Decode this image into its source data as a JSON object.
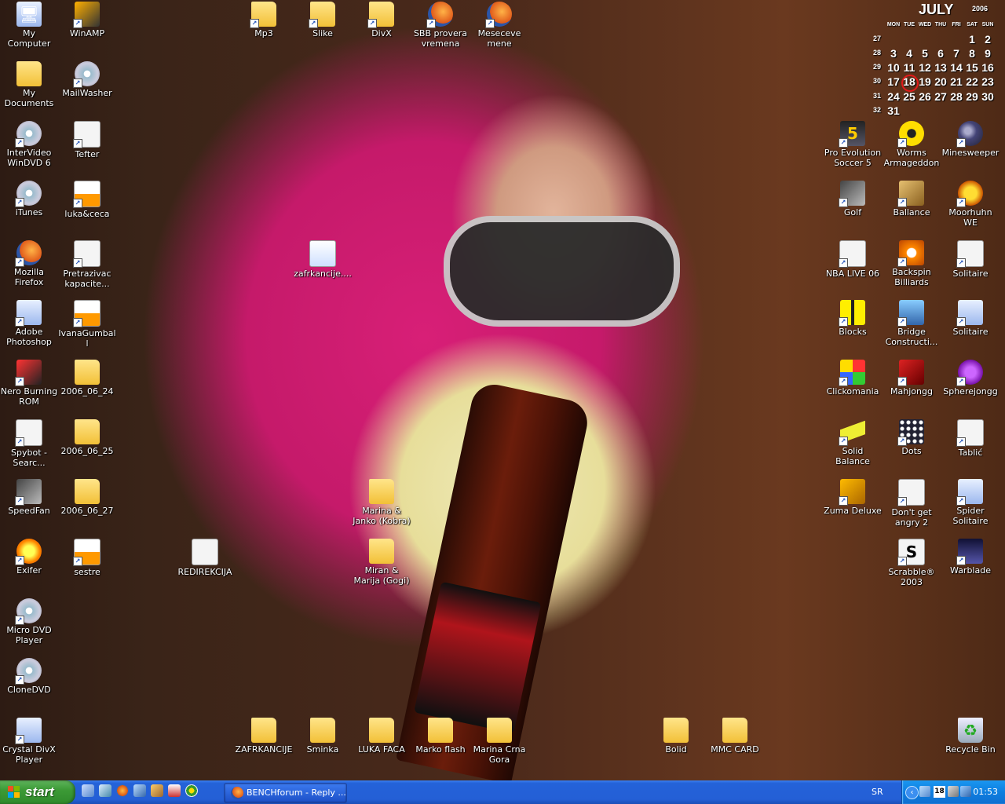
{
  "desktop_icons": {
    "col1": [
      {
        "label": "My Computer"
      },
      {
        "label": "My Documents"
      },
      {
        "label": "InterVideo WinDVD 6"
      },
      {
        "label": "iTunes"
      },
      {
        "label": "Mozilla Firefox"
      },
      {
        "label": "Adobe Photoshop"
      },
      {
        "label": "Nero Burning ROM"
      },
      {
        "label": "Spybot - Searc..."
      },
      {
        "label": "SpeedFan"
      },
      {
        "label": "Exifer"
      },
      {
        "label": "Micro DVD Player"
      },
      {
        "label": "CloneDVD"
      },
      {
        "label": "Crystal DivX Player"
      }
    ],
    "col2": [
      {
        "label": "WinAMP"
      },
      {
        "label": "MailWasher"
      },
      {
        "label": "Tefter"
      },
      {
        "label": "luka&ceca"
      },
      {
        "label": "Pretrazivac kapacite..."
      },
      {
        "label": "IvanaGumball"
      },
      {
        "label": "2006_06_24"
      },
      {
        "label": "2006_06_25"
      },
      {
        "label": "2006_06_27"
      },
      {
        "label": "sestre"
      }
    ],
    "top_row": [
      {
        "label": "Mp3"
      },
      {
        "label": "Slike"
      },
      {
        "label": "DivX"
      },
      {
        "label": "SBB provera vremena"
      },
      {
        "label": "Meseceve mene"
      }
    ],
    "middle": [
      {
        "label": "zafrkancije...."
      },
      {
        "label": "REDIREKCIJA"
      },
      {
        "label": "Marina & Janko (Kobra)"
      },
      {
        "label": "Miran & Marija (Gogi)"
      }
    ],
    "bottom_row": [
      {
        "label": "ZAFRKANCIJE"
      },
      {
        "label": "Sminka"
      },
      {
        "label": "LUKA FACA"
      },
      {
        "label": "Marko flash"
      },
      {
        "label": "Marina Crna Gora"
      },
      {
        "label": "Bolid"
      },
      {
        "label": "MMC CARD"
      }
    ],
    "right_games": [
      {
        "label": "Pro Evolution Soccer 5"
      },
      {
        "label": "Worms Armageddon"
      },
      {
        "label": "Minesweeper"
      },
      {
        "label": "Golf"
      },
      {
        "label": "Ballance"
      },
      {
        "label": "Moorhuhn WE"
      },
      {
        "label": "NBA LIVE 06"
      },
      {
        "label": "Backspin Billiards"
      },
      {
        "label": "Solitaire"
      },
      {
        "label": "Blocks"
      },
      {
        "label": "Bridge Constructi..."
      },
      {
        "label": "Solitaire"
      },
      {
        "label": "Clickomania"
      },
      {
        "label": "Mahjongg"
      },
      {
        "label": "Spherejongg"
      },
      {
        "label": "Solid Balance"
      },
      {
        "label": "Dots"
      },
      {
        "label": "Tablić"
      },
      {
        "label": "Zuma Deluxe"
      },
      {
        "label": "Don't get angry 2"
      },
      {
        "label": "Spider Solitaire"
      },
      {
        "label": "Scrabble® 2003"
      },
      {
        "label": "Warblade"
      }
    ],
    "recycle": {
      "label": "Recycle Bin"
    }
  },
  "calendar": {
    "month": "JULY",
    "year": "2006",
    "weekdays": [
      "MON",
      "TUE",
      "WED",
      "THU",
      "FRI",
      "SAT",
      "SUN"
    ],
    "weeks": [
      "27",
      "28",
      "29",
      "30",
      "31",
      "32"
    ],
    "rows": [
      [
        "",
        "",
        "",
        "",
        "",
        "1",
        "2"
      ],
      [
        "3",
        "4",
        "5",
        "6",
        "7",
        "8",
        "9"
      ],
      [
        "10",
        "11",
        "12",
        "13",
        "14",
        "15",
        "16"
      ],
      [
        "17",
        "18",
        "19",
        "20",
        "21",
        "22",
        "23"
      ],
      [
        "24",
        "25",
        "26",
        "27",
        "28",
        "29",
        "30"
      ],
      [
        "31",
        "",
        "",
        "",
        "",
        "",
        ""
      ]
    ],
    "today": "18"
  },
  "taskbar": {
    "start_label": "start",
    "task_button": "BENCHforum - Reply ...",
    "language": "SR",
    "tray_calendar_day": "18",
    "clock": "01:53"
  }
}
